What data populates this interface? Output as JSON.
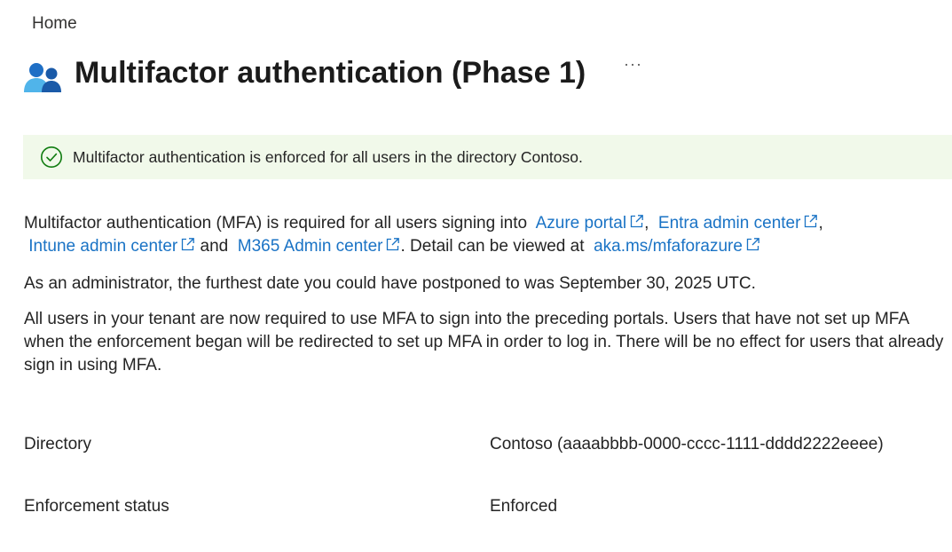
{
  "breadcrumb": {
    "home": "Home"
  },
  "header": {
    "title": "Multifactor authentication (Phase 1)",
    "more_label": "···",
    "icon": "users-icon"
  },
  "banner": {
    "icon": "success-check-icon",
    "text": "Multifactor authentication is enforced for all users in the directory Contoso.",
    "color": "#f1f9ea"
  },
  "intro": {
    "prefix": "Multifactor authentication (MFA) is required for all users signing into",
    "link_azure": "Azure portal",
    "sep1": ",",
    "link_entra": "Entra admin center",
    "sep2": ",",
    "link_intune": "Intune admin center",
    "and": "and",
    "link_m365": "M365 Admin center",
    "detail": ". Detail can be viewed at",
    "link_aka": "aka.ms/mfaforazure"
  },
  "postpone_text": "As an administrator, the furthest date you could have postponed to was September 30, 2025 UTC.",
  "requirement_text": "All users in your tenant are now required to use MFA to sign into the preceding portals. Users that have not set up MFA when the enforcement began will be redirected to set up MFA in order to log in. There will be no effect for users that already sign in using MFA.",
  "properties": [
    {
      "label": "Directory",
      "value": "Contoso (aaaabbbb-0000-cccc-1111-dddd2222eeee)"
    },
    {
      "label": "Enforcement status",
      "value": "Enforced"
    }
  ],
  "colors": {
    "link": "#1a73c5",
    "success": "#107c10"
  }
}
